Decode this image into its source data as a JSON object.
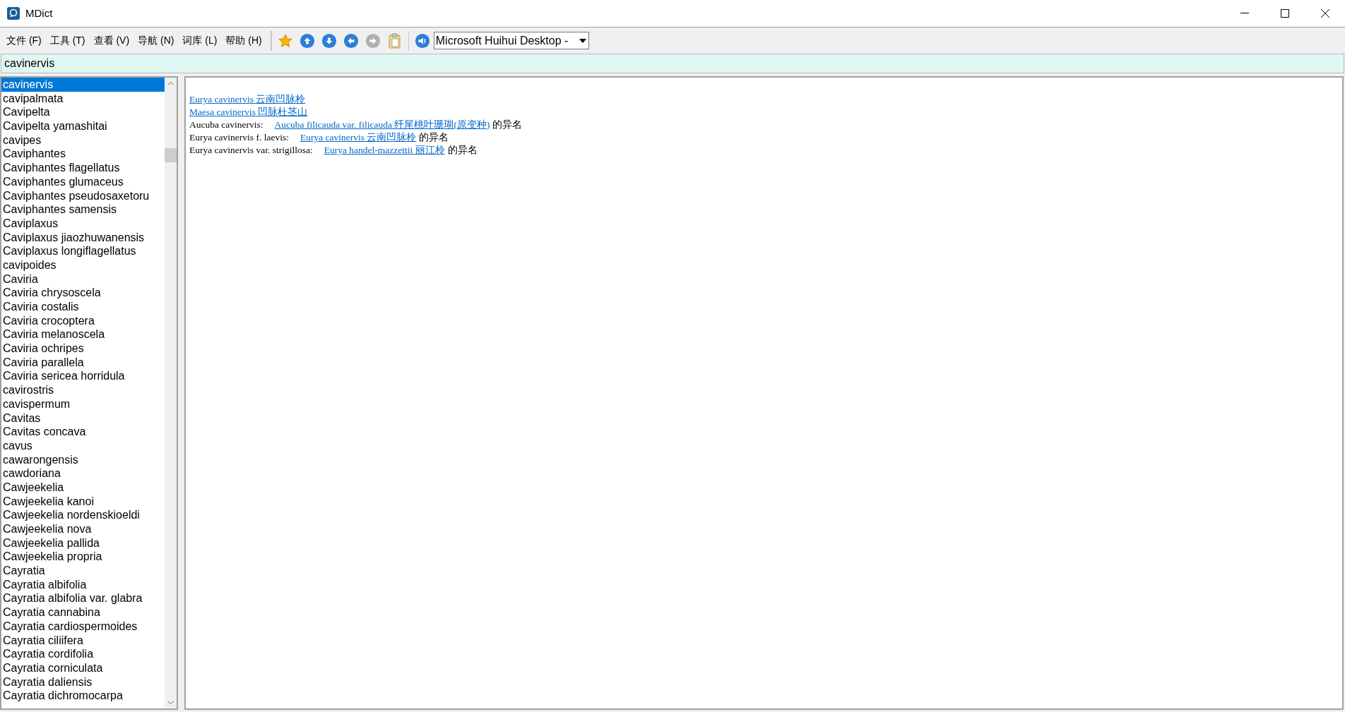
{
  "window": {
    "title": "MDict"
  },
  "menu": [
    "文件 (F)",
    "工具 (T)",
    "查看 (V)",
    "导航 (N)",
    "词库 (L)",
    "帮助 (H)"
  ],
  "toolbar": [
    {
      "kind": "star",
      "disabled": false
    },
    {
      "kind": "up",
      "disabled": false
    },
    {
      "kind": "down",
      "disabled": false
    },
    {
      "kind": "back",
      "disabled": false
    },
    {
      "kind": "forward",
      "disabled": true
    },
    {
      "kind": "clipboard",
      "disabled": false
    }
  ],
  "voice": {
    "value": "Microsoft Huihui Desktop -"
  },
  "search": {
    "value": "cavinervis"
  },
  "word_list": [
    {
      "text": "cavinervis",
      "selected": true
    },
    {
      "text": "cavipalmata",
      "selected": false
    },
    {
      "text": "Cavipelta",
      "selected": false
    },
    {
      "text": "Cavipelta yamashitai",
      "selected": false
    },
    {
      "text": "cavipes",
      "selected": false
    },
    {
      "text": "Caviphantes",
      "selected": false
    },
    {
      "text": "Caviphantes flagellatus",
      "selected": false
    },
    {
      "text": "Caviphantes glumaceus",
      "selected": false
    },
    {
      "text": "Caviphantes pseudosaxetoru",
      "selected": false
    },
    {
      "text": "Caviphantes samensis",
      "selected": false
    },
    {
      "text": "Caviplaxus",
      "selected": false
    },
    {
      "text": "Caviplaxus jiaozhuwanensis",
      "selected": false
    },
    {
      "text": "Caviplaxus longiflagellatus",
      "selected": false
    },
    {
      "text": "cavipoides",
      "selected": false
    },
    {
      "text": "Caviria",
      "selected": false
    },
    {
      "text": "Caviria chrysoscela",
      "selected": false
    },
    {
      "text": "Caviria costalis",
      "selected": false
    },
    {
      "text": "Caviria crocoptera",
      "selected": false
    },
    {
      "text": "Caviria melanoscela",
      "selected": false
    },
    {
      "text": "Caviria ochripes",
      "selected": false
    },
    {
      "text": "Caviria parallela",
      "selected": false
    },
    {
      "text": "Caviria sericea  horridula",
      "selected": false
    },
    {
      "text": "cavirostris",
      "selected": false
    },
    {
      "text": "cavispermum",
      "selected": false
    },
    {
      "text": "Cavitas",
      "selected": false
    },
    {
      "text": "Cavitas concava",
      "selected": false
    },
    {
      "text": "cavus",
      "selected": false
    },
    {
      "text": "cawarongensis",
      "selected": false
    },
    {
      "text": "cawdoriana",
      "selected": false
    },
    {
      "text": "Cawjeekelia",
      "selected": false
    },
    {
      "text": "Cawjeekelia kanoi",
      "selected": false
    },
    {
      "text": "Cawjeekelia nordenskioeldi",
      "selected": false
    },
    {
      "text": "Cawjeekelia nova",
      "selected": false
    },
    {
      "text": "Cawjeekelia pallida",
      "selected": false
    },
    {
      "text": "Cawjeekelia propria",
      "selected": false
    },
    {
      "text": "Cayratia",
      "selected": false
    },
    {
      "text": "Cayratia albifolia",
      "selected": false
    },
    {
      "text": "Cayratia albifolia var. glabra",
      "selected": false
    },
    {
      "text": "Cayratia cannabina",
      "selected": false
    },
    {
      "text": "Cayratia cardiospermoides",
      "selected": false
    },
    {
      "text": "Cayratia ciliifera",
      "selected": false
    },
    {
      "text": "Cayratia cordifolia",
      "selected": false
    },
    {
      "text": "Cayratia corniculata",
      "selected": false
    },
    {
      "text": "Cayratia daliensis",
      "selected": false
    },
    {
      "text": "Cayratia dichromocarpa",
      "selected": false
    }
  ],
  "entries": [
    {
      "link": "Eurya cavinervis 云南凹脉柃"
    },
    {
      "link": "Maesa cavinervis 凹脉杜茎山"
    },
    {
      "term": "Aucuba cavinervis:",
      "link": "Aucuba filicauda var. filicauda 纤尾桃叶珊瑚(原变种)",
      "suffix": "的异名"
    },
    {
      "term": "Eurya cavinervis f. laevis:",
      "link": "Eurya cavinervis 云南凹脉柃",
      "suffix": "的异名"
    },
    {
      "term": "Eurya cavinervis var. strigillosa:",
      "link": "Eurya handel-mazzettii 丽江柃",
      "suffix": "的异名"
    }
  ]
}
